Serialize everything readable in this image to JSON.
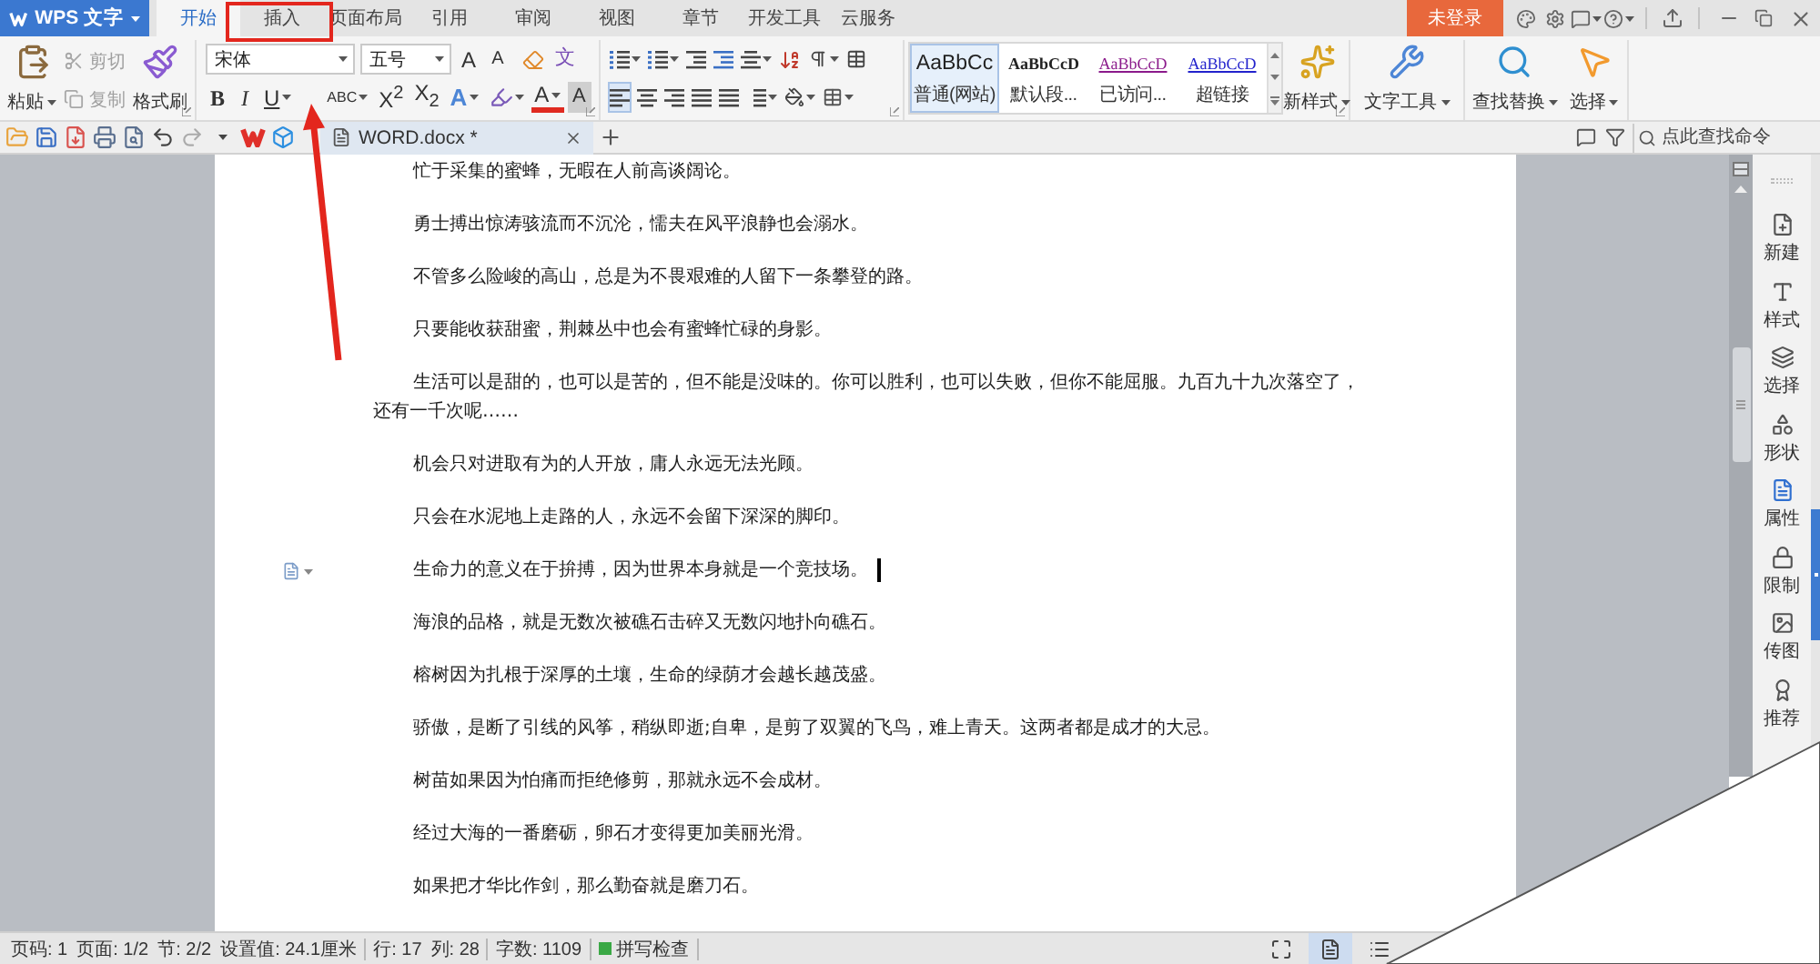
{
  "app_menu": {
    "label": "WPS 文字"
  },
  "tabs": [
    {
      "label": "开始",
      "selected": true,
      "highlighted": false
    },
    {
      "label": "插入",
      "selected": false,
      "highlighted": true
    },
    {
      "label": "页面布局",
      "selected": false,
      "highlighted": false
    },
    {
      "label": "引用",
      "selected": false,
      "highlighted": false
    },
    {
      "label": "审阅",
      "selected": false,
      "highlighted": false
    },
    {
      "label": "视图",
      "selected": false,
      "highlighted": false
    },
    {
      "label": "章节",
      "selected": false,
      "highlighted": false
    },
    {
      "label": "开发工具",
      "selected": false,
      "highlighted": false
    },
    {
      "label": "云服务",
      "selected": false,
      "highlighted": false
    }
  ],
  "login_button": {
    "label": "未登录"
  },
  "pointer_arrow": true,
  "clipboard": [
    {
      "kind": "paste",
      "label": "粘贴",
      "dropdown": true,
      "disabled": false
    },
    {
      "kind": "cut",
      "label": "剪切",
      "dropdown": false,
      "disabled": true
    },
    {
      "kind": "copy",
      "label": "复制",
      "dropdown": false,
      "disabled": true
    },
    {
      "kind": "painter",
      "label": "格式刷",
      "dropdown": false,
      "disabled": false
    }
  ],
  "font": {
    "name": "宋体",
    "size": "五号",
    "tools": [
      {
        "kind": "grow",
        "glyph": "A"
      },
      {
        "kind": "shrink",
        "glyph": "A"
      },
      {
        "kind": "clear"
      },
      {
        "kind": "pinyin",
        "glyph": "文"
      }
    ],
    "buttons": [
      {
        "kind": "bold",
        "glyph": "B"
      },
      {
        "kind": "italic",
        "glyph": "I"
      },
      {
        "kind": "underline",
        "glyph": "U"
      },
      {
        "kind": "strike",
        "glyph": "ABC"
      },
      {
        "kind": "superscript",
        "glyph": "X$^{2}$"
      },
      {
        "kind": "subscript",
        "glyph": "X$_{2}$"
      },
      {
        "kind": "effects",
        "glyph": "A"
      },
      {
        "kind": "highlight"
      },
      {
        "kind": "color",
        "glyph": "A"
      },
      {
        "kind": "shading",
        "glyph": "A"
      }
    ]
  },
  "paragraph": {
    "alignment": [
      {
        "kind": "left",
        "selected": true
      },
      {
        "kind": "center",
        "selected": false
      },
      {
        "kind": "right",
        "selected": false
      },
      {
        "kind": "justify",
        "selected": false
      },
      {
        "kind": "distributed",
        "selected": false
      }
    ]
  },
  "styles": [
    {
      "kind": "normal",
      "sample": "AaBbCc",
      "label": "普通(网站)",
      "selected": true
    },
    {
      "kind": "default",
      "sample": "AaBbCcD",
      "label": "默认段...",
      "selected": false
    },
    {
      "kind": "visited",
      "sample": "AaBbCcD",
      "label": "已访问...",
      "selected": false
    },
    {
      "kind": "link",
      "sample": "AaBbCcD",
      "label": "超链接",
      "selected": false
    }
  ],
  "tools": [
    {
      "kind": "new_style",
      "label": "新样式"
    },
    {
      "kind": "text_tools",
      "label": "文字工具"
    },
    {
      "kind": "find_replace",
      "label": "查找替换"
    },
    {
      "kind": "select",
      "label": "选择"
    }
  ],
  "document_tab": {
    "title": "WORD.docx *",
    "selected": true
  },
  "command_search": {
    "placeholder": "点此查找命令"
  },
  "paragraphs": [
    {
      "text": "忙于采集的蜜蜂，无暇在人前高谈阔论。",
      "cursor": false
    },
    {
      "text": "勇士搏出惊涛骇流而不沉沦，懦夫在风平浪静也会溺水。",
      "cursor": false
    },
    {
      "text": "不管多么险峻的高山，总是为不畏艰难的人留下一条攀登的路。",
      "cursor": false
    },
    {
      "text": "只要能收获甜蜜，荆棘丛中也会有蜜蜂忙碌的身影。",
      "cursor": false
    },
    {
      "text": "生活可以是甜的，也可以是苦的，但不能是没味的。你可以胜利，也可以失败，但你不能屈服。九百九十九次落空了，还有一千次呢……",
      "cursor": false
    },
    {
      "text": "机会只对进取有为的人开放，庸人永远无法光顾。",
      "cursor": false
    },
    {
      "text": "只会在水泥地上走路的人，永远不会留下深深的脚印。",
      "cursor": false
    },
    {
      "text": "生命力的意义在于拚搏，因为世界本身就是一个竞技场。",
      "cursor": true
    },
    {
      "text": "海浪的品格，就是无数次被礁石击碎又无数闪地扑向礁石。",
      "cursor": false
    },
    {
      "text": "榕树因为扎根于深厚的土壤，生命的绿荫才会越长越茂盛。",
      "cursor": false
    },
    {
      "text": "骄傲，是断了引线的风筝，稍纵即逝;自卑，是剪了双翼的飞鸟，难上青天。这两者都是成才的大忌。",
      "cursor": false
    },
    {
      "text": "树苗如果因为怕痛而拒绝修剪，那就永远不会成材。",
      "cursor": false
    },
    {
      "text": "经过大海的一番磨砺，卵石才变得更加美丽光滑。",
      "cursor": false
    },
    {
      "text": "如果把才华比作剑，那么勤奋就是磨刀石。",
      "cursor": false
    }
  ],
  "sidebar": [
    {
      "label": "新建",
      "selected": false
    },
    {
      "label": "样式",
      "selected": false
    },
    {
      "label": "选择",
      "selected": false
    },
    {
      "label": "形状",
      "selected": false
    },
    {
      "label": "属性",
      "selected": true
    },
    {
      "label": "限制",
      "selected": false
    },
    {
      "label": "传图",
      "selected": false
    },
    {
      "label": "推荐",
      "selected": false
    }
  ],
  "status_bar": {
    "groups": [
      [
        "页码: 1",
        "页面: 1/2",
        "节: 2/2",
        "设置值: 24.1厘米"
      ],
      [
        "行: 17",
        "列: 28"
      ],
      [
        "字数: 1109"
      ]
    ],
    "spell_check": {
      "label": "拼写检查",
      "on": true
    },
    "views": [
      {
        "kind": "fullscreen",
        "selected": false
      },
      {
        "kind": "page",
        "selected": true
      },
      {
        "kind": "outline",
        "selected": false
      }
    ]
  },
  "page_curl": true
}
